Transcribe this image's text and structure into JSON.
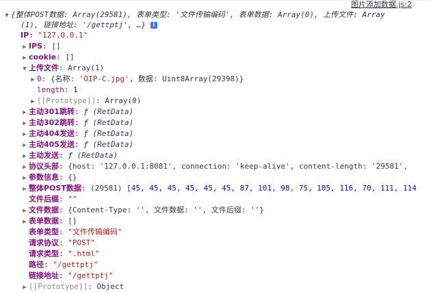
{
  "source_link": "图片添加数据.js:2",
  "summary": {
    "line1": "{整体POST数据: Array(29581), 表单类型: '文件传输编码', 表单数据: Array(0), 上传文件: Array",
    "line2": "(1), 链接地址: '/gettptj', …}"
  },
  "props": {
    "ip": {
      "key": "IP",
      "value": "\"127.0.0.1\""
    },
    "ips": {
      "key": "IPS",
      "value": "[]"
    },
    "cookie": {
      "key": "cookie",
      "value": "[]"
    },
    "upload": {
      "key": "上传文件",
      "value": "Array(1)"
    },
    "upload0": {
      "key": "0",
      "value_a": "{名称: ",
      "value_b": "'OIP-C.jpg'",
      "value_c": ", 数据: Uint8Array(29398)}"
    },
    "length": {
      "key": "length",
      "value": "1"
    },
    "proto_arr": {
      "key": "[[Prototype]]",
      "value": "Array(0)"
    },
    "r301": {
      "key": "主动301跳转",
      "f": "ƒ",
      "value": "(RetData)"
    },
    "r302": {
      "key": "主动302跳转",
      "f": "ƒ",
      "value": "(RetData)"
    },
    "s404": {
      "key": "主动404发送",
      "f": "ƒ",
      "value": "(RetData)"
    },
    "s405": {
      "key": "主动405发送",
      "f": "ƒ",
      "value": "(RetData)"
    },
    "send": {
      "key": "主动发送",
      "f": "ƒ",
      "value": "(RetData)"
    },
    "headers": {
      "key": "协议头部",
      "value": "{host: '127.0.0.1:8081', connection: 'keep-alive', content-length: '29581',"
    },
    "params": {
      "key": "参数信息",
      "value": "{}"
    },
    "post": {
      "key": "整体POST数据",
      "count": "(29581)",
      "value": "[45, 45, 45, 45, 45, 45, 87, 101, 98, 75, 105, 116, 70, 111, 114"
    },
    "suffix": {
      "key": "文件后缀",
      "value": "\"\""
    },
    "filedata": {
      "key": "文件数据",
      "value": "{Content-Type: '', 文件数据: '', 文件后缀: ''}"
    },
    "formdata": {
      "key": "表单数据",
      "value": "[]"
    },
    "formtype": {
      "key": "表单类型",
      "value": "\"文件传输编码\""
    },
    "method": {
      "key": "请求协议",
      "value": "\"POST\""
    },
    "reqtype": {
      "key": "请求类型",
      "value": "\".html\""
    },
    "path": {
      "key": "路径",
      "value": "\"/gettptj\""
    },
    "link": {
      "key": "链接地址",
      "value": "\"/gettptj\""
    },
    "proto_obj": {
      "key": "[[Prototype]]",
      "value": "Object"
    }
  }
}
